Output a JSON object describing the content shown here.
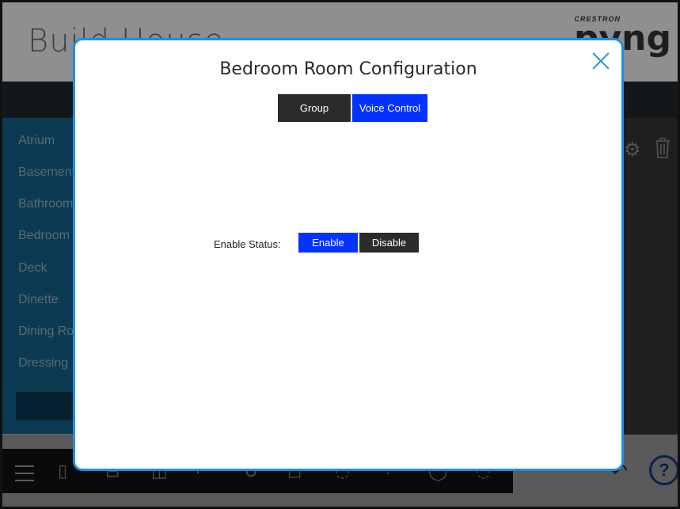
{
  "app": {
    "title": "Build House",
    "brand_small": "CRESTRON",
    "brand_big": "pyng"
  },
  "rooms": [
    "Atrium",
    "Basement",
    "Bathroom",
    "Bedroom",
    "Deck",
    "Dinette",
    "Dining Room",
    "Dressing"
  ],
  "modal": {
    "title": "Bedroom Room Configuration",
    "tabs": [
      {
        "label": "Group",
        "active": false
      },
      {
        "label": "Voice Control",
        "active": true
      }
    ],
    "enable_status_label": "Enable Status:",
    "enable_label": "Enable",
    "disable_label": "Disable",
    "selected": "Enable"
  },
  "icons": {
    "close": "close-icon",
    "settings": "gear-icon",
    "delete": "trash-icon",
    "menu": "hamburger-icon",
    "help": "help-icon",
    "back": "back-icon"
  },
  "colors": {
    "accent": "#0433ff",
    "modal_border": "#1d8fe6",
    "dark_button": "#2b2b2b"
  },
  "help_glyph": "?"
}
